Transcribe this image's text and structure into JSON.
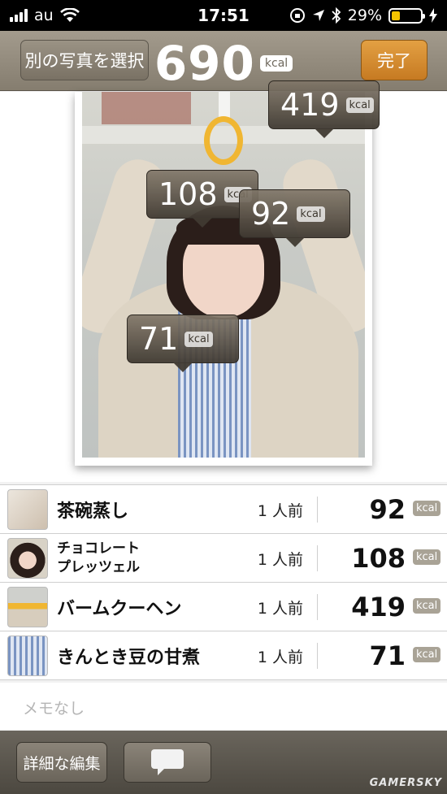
{
  "status_bar": {
    "carrier": "au",
    "time": "17:51",
    "battery": "29%",
    "battery_level": 0.29
  },
  "navbar": {
    "left_button": "別の写真を選択",
    "total_kcal": "690",
    "kcal_unit": "kcal",
    "done_button": "完了"
  },
  "photo_callouts": [
    {
      "value": "419",
      "unit": "kcal"
    },
    {
      "value": "108",
      "unit": "kcal"
    },
    {
      "value": "92",
      "unit": "kcal"
    },
    {
      "value": "71",
      "unit": "kcal"
    }
  ],
  "items": [
    {
      "name": "茶碗蒸し",
      "portion": "1 人前",
      "kcal": "92",
      "unit": "kcal"
    },
    {
      "name": "チョコレート\nプレッツェル",
      "portion": "1 人前",
      "kcal": "108",
      "unit": "kcal"
    },
    {
      "name": "バームクーヘン",
      "portion": "1 人前",
      "kcal": "419",
      "unit": "kcal"
    },
    {
      "name": "きんとき豆の甘煮",
      "portion": "1 人前",
      "kcal": "71",
      "unit": "kcal"
    }
  ],
  "memo": "メモなし",
  "toolbar": {
    "edit_button": "詳細な編集",
    "comment_icon": "speech-bubble-icon"
  },
  "watermark": "GAMERSKY"
}
